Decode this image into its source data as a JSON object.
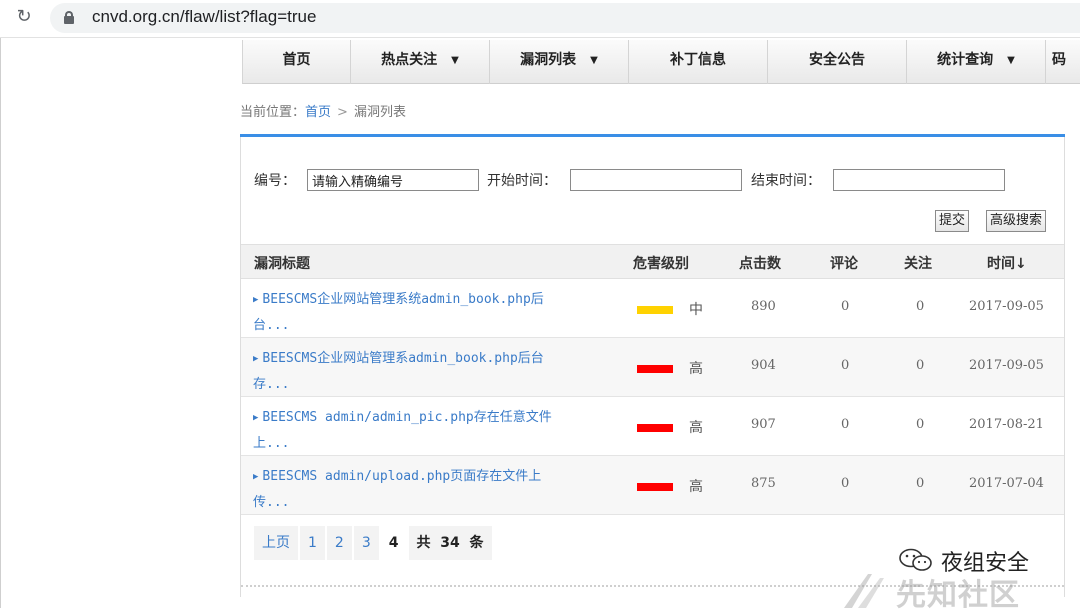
{
  "browser": {
    "url": "cnvd.org.cn/flaw/list?flag=true",
    "reload_icon": "reload-icon",
    "lock_icon": "lock-icon"
  },
  "nav": {
    "items": [
      {
        "label": "首页",
        "dropdown": false
      },
      {
        "label": "热点关注",
        "dropdown": true
      },
      {
        "label": "漏洞列表",
        "dropdown": true
      },
      {
        "label": "补丁信息",
        "dropdown": false
      },
      {
        "label": "安全公告",
        "dropdown": false
      },
      {
        "label": "统计查询",
        "dropdown": true
      },
      {
        "label": "码",
        "dropdown": false
      }
    ],
    "caret": "▼"
  },
  "breadcrumb": {
    "prefix": "当前位置：",
    "home": "首页",
    "separator": ">",
    "current": "漏洞列表"
  },
  "search": {
    "id_label": "编号：",
    "id_value": "请输入精确编号",
    "start_label": "开始时间：",
    "start_value": "",
    "end_label": "结束时间：",
    "end_value": "",
    "submit_label": "提交",
    "advanced_label": "高级搜索"
  },
  "table": {
    "headers": {
      "title": "漏洞标题",
      "severity": "危害级别",
      "clicks": "点击数",
      "comments": "评论",
      "follows": "关注",
      "time": "时间"
    },
    "sort_arrow": "↓",
    "row_arrow": "▶",
    "rows": [
      {
        "title_line1": "BEESCMS企业网站管理系统admin_book.php后",
        "title_line2": "台...",
        "severity": "中",
        "severity_color": "#ffd200",
        "clicks": "890",
        "comments": "0",
        "follows": "0",
        "time": "2017-09-05"
      },
      {
        "title_line1": "BEESCMS企业网站管理系admin_book.php后台",
        "title_line2": "存...",
        "severity": "高",
        "severity_color": "#ff0000",
        "clicks": "904",
        "comments": "0",
        "follows": "0",
        "time": "2017-09-05"
      },
      {
        "title_line1": "BEESCMS admin/admin_pic.php存在任意文件",
        "title_line2": "上...",
        "severity": "高",
        "severity_color": "#ff0000",
        "clicks": "907",
        "comments": "0",
        "follows": "0",
        "time": "2017-08-21"
      },
      {
        "title_line1": "BEESCMS admin/upload.php页面存在文件上",
        "title_line2": "传...",
        "severity": "高",
        "severity_color": "#ff0000",
        "clicks": "875",
        "comments": "0",
        "follows": "0",
        "time": "2017-07-04"
      }
    ]
  },
  "pagination": {
    "prev": "上页",
    "pages": [
      "1",
      "2",
      "3"
    ],
    "current": "4",
    "total_prefix": "共",
    "total": "34",
    "total_suffix": "条"
  },
  "watermark": {
    "wechat_text": "夜组安全",
    "site_text": "先知社区"
  }
}
